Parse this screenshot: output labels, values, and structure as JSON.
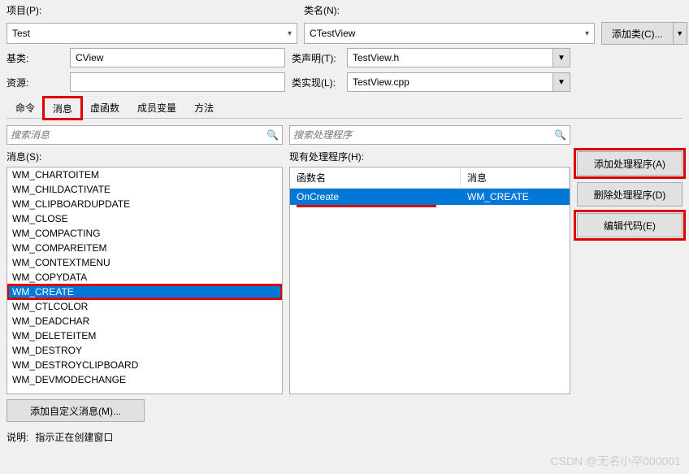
{
  "labels": {
    "project": "项目(P):",
    "class_name": "类名(N):",
    "base_class": "基类:",
    "class_decl": "类声明(T):",
    "resource": "资源:",
    "class_impl": "类实现(L):",
    "messages_section": "消息(S):",
    "handlers_section": "现有处理程序(H):",
    "func_col": "函数名",
    "msg_col": "消息",
    "desc_prefix": "说明:",
    "desc_text": "指示正在创建窗口"
  },
  "values": {
    "project": "Test",
    "class_name": "CTestView",
    "base_class": "CView",
    "class_decl": "TestView.h",
    "class_impl": "TestView.cpp",
    "resource": ""
  },
  "placeholders": {
    "search_messages": "搜索消息",
    "search_handlers": "搜索处理程序"
  },
  "buttons": {
    "add_class": "添加类(C)...",
    "add_handler": "添加处理程序(A)",
    "del_handler": "删除处理程序(D)",
    "edit_code": "编辑代码(E)",
    "add_custom": "添加自定义消息(M)..."
  },
  "tabs": [
    "命令",
    "消息",
    "虚函数",
    "成员变量",
    "方法"
  ],
  "active_tab": 1,
  "messages": [
    "WM_CHARTOITEM",
    "WM_CHILDACTIVATE",
    "WM_CLIPBOARDUPDATE",
    "WM_CLOSE",
    "WM_COMPACTING",
    "WM_COMPAREITEM",
    "WM_CONTEXTMENU",
    "WM_COPYDATA",
    "WM_CREATE",
    "WM_CTLCOLOR",
    "WM_DEADCHAR",
    "WM_DELETEITEM",
    "WM_DESTROY",
    "WM_DESTROYCLIPBOARD",
    "WM_DEVMODECHANGE"
  ],
  "selected_message_index": 8,
  "handlers": [
    {
      "func": "OnCreate",
      "msg": "WM_CREATE"
    }
  ],
  "selected_handler_index": 0,
  "watermark": "CSDN @无名小卒000001"
}
